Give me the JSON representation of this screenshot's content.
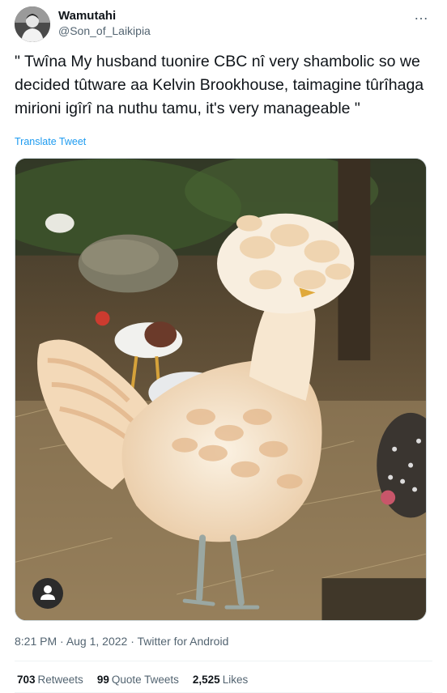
{
  "author": {
    "display_name": "Wamutahi",
    "handle": "@Son_of_Laikipia",
    "avatar_icon": "user-avatar"
  },
  "more_icon": "…",
  "tweet": {
    "text": "\" Twîna My husband tuonire CBC nî very shambolic so we decided tûtware aa Kelvin Brookhouse, taimagine tûrîhaga mirioni igîrî na nuthu tamu, it's very manageable \"",
    "translate_label": "Translate Tweet"
  },
  "media": {
    "icon": "person-icon"
  },
  "meta": {
    "time": "8:21 PM",
    "sep1": " · ",
    "date": "Aug 1, 2022",
    "sep2": " · ",
    "source": "Twitter for Android"
  },
  "stats": {
    "retweets_count": "703",
    "retweets_label": "Retweets",
    "quotes_count": "99",
    "quotes_label": "Quote Tweets",
    "likes_count": "2,525",
    "likes_label": "Likes"
  }
}
